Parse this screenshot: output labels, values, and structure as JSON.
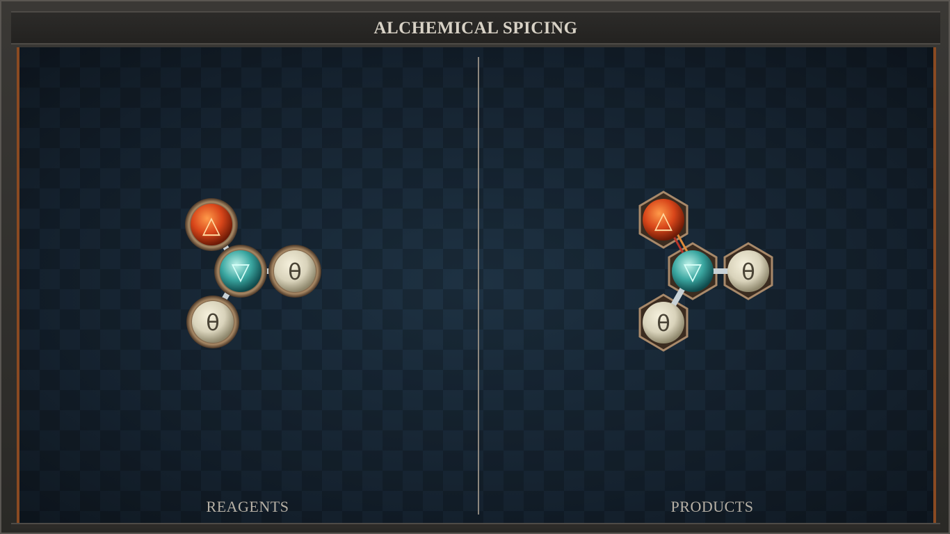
{
  "title": "ALCHEMICAL SPICING",
  "panels": {
    "left_label": "REAGENTS",
    "right_label": "PRODUCTS"
  },
  "symbols": {
    "fire": "△",
    "water": "▽",
    "salt": "θ"
  },
  "colors": {
    "fire": "#d8461a",
    "water": "#3aa6a0",
    "salt": "#d9d3bb",
    "frame_accent": "#8a4a22",
    "board": "#15222f"
  }
}
